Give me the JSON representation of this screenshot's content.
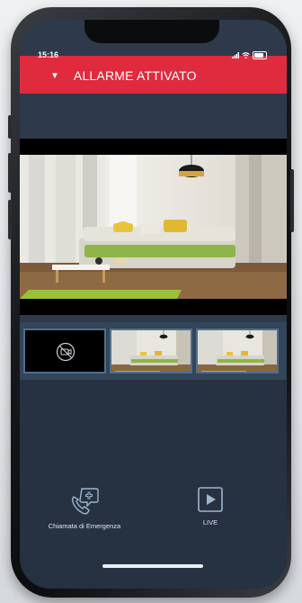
{
  "status_bar": {
    "time": "15:16"
  },
  "header": {
    "title": "ALLARME ATTIVATO",
    "collapse_icon": "caret-down-icon"
  },
  "thumbnails": [
    {
      "kind": "no-camera",
      "icon": "camera-off-icon"
    },
    {
      "kind": "camera-view"
    },
    {
      "kind": "camera-view"
    }
  ],
  "actions": {
    "emergency_label": "Chiamata di Emergenza",
    "emergency_icon": "emergency-call-icon",
    "live_label": "LIVE",
    "live_icon": "play-icon"
  },
  "colors": {
    "header": "#e02b3e",
    "background": "#263142",
    "accent": "#4e6e8e"
  }
}
